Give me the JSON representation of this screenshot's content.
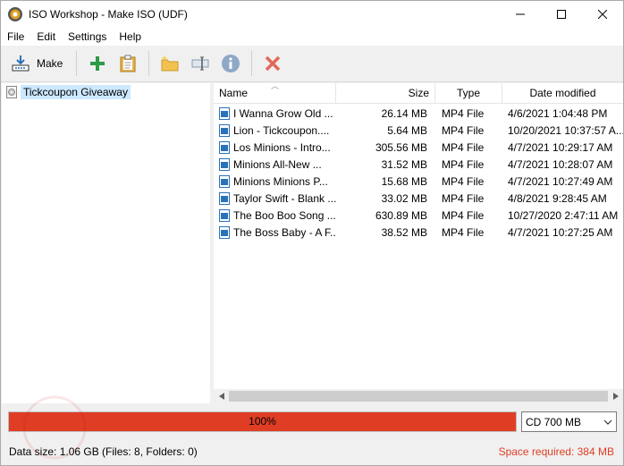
{
  "window": {
    "title": "ISO Workshop - Make ISO (UDF)"
  },
  "menu": {
    "items": [
      "File",
      "Edit",
      "Settings",
      "Help"
    ]
  },
  "toolbar": {
    "make_label": "Make",
    "icons": [
      "make-disc-icon",
      "add-icon",
      "paste-icon",
      "new-folder-icon",
      "rename-icon",
      "info-icon",
      "delete-icon"
    ]
  },
  "tree": {
    "root_label": "Tickcoupon Giveaway"
  },
  "list": {
    "columns": [
      "Name",
      "Size",
      "Type",
      "Date modified"
    ],
    "rows": [
      {
        "name": "I Wanna Grow Old ...",
        "size": "26.14 MB",
        "type": "MP4 File",
        "date": "4/6/2021 1:04:48 PM"
      },
      {
        "name": "Lion - Tickcoupon....",
        "size": "5.64 MB",
        "type": "MP4 File",
        "date": "10/20/2021 10:37:57 A..."
      },
      {
        "name": "Los Minions - Intro...",
        "size": "305.56 MB",
        "type": "MP4 File",
        "date": "4/7/2021 10:29:17 AM"
      },
      {
        "name": "Minions  All-New ...",
        "size": "31.52 MB",
        "type": "MP4 File",
        "date": "4/7/2021 10:28:07 AM"
      },
      {
        "name": "Minions  Minions P...",
        "size": "15.68 MB",
        "type": "MP4 File",
        "date": "4/7/2021 10:27:49 AM"
      },
      {
        "name": "Taylor Swift - Blank ...",
        "size": "33.02 MB",
        "type": "MP4 File",
        "date": "4/8/2021 9:28:45 AM"
      },
      {
        "name": "The Boo Boo Song ...",
        "size": "630.89 MB",
        "type": "MP4 File",
        "date": "10/27/2020 2:47:11 AM"
      },
      {
        "name": "The Boss Baby - A F...",
        "size": "38.52 MB",
        "type": "MP4 File",
        "date": "4/7/2021 10:27:25 AM"
      }
    ]
  },
  "progress": {
    "label": "100%",
    "percent": 100,
    "color": "#e03d25"
  },
  "capacity": {
    "selected": "CD 700 MB"
  },
  "status": {
    "data_size": "Data size: 1.06 GB (Files: 8, Folders: 0)",
    "space_required": "Space required: 384 MB"
  }
}
